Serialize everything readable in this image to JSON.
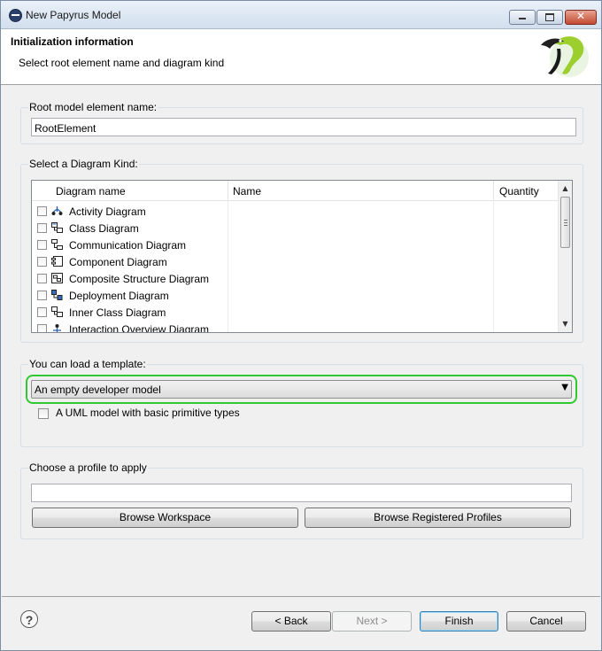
{
  "window": {
    "title": "New Papyrus Model",
    "controls": [
      "minimize-icon",
      "maximize-icon",
      "close-icon"
    ]
  },
  "header": {
    "title": "Initialization information",
    "subtitle": "Select root element name and diagram kind"
  },
  "root_element": {
    "label": "Root model element name:",
    "value": "RootElement"
  },
  "diagram_kind": {
    "label": "Select a Diagram Kind:",
    "columns": [
      "Diagram name",
      "Name",
      "Quantity"
    ],
    "rows": [
      {
        "label": "Activity Diagram",
        "icon": "activity-diagram-icon",
        "checked": false
      },
      {
        "label": "Class Diagram",
        "icon": "class-diagram-icon",
        "checked": false
      },
      {
        "label": "Communication Diagram",
        "icon": "communication-diagram-icon",
        "checked": false
      },
      {
        "label": "Component Diagram",
        "icon": "component-diagram-icon",
        "checked": false
      },
      {
        "label": "Composite Structure Diagram",
        "icon": "composite-structure-diagram-icon",
        "checked": false
      },
      {
        "label": "Deployment Diagram",
        "icon": "deployment-diagram-icon",
        "checked": false
      },
      {
        "label": "Inner Class Diagram",
        "icon": "inner-class-diagram-icon",
        "checked": false
      },
      {
        "label": "Interaction Overview Diagram",
        "icon": "interaction-overview-diagram-icon",
        "checked": false
      }
    ]
  },
  "template": {
    "label": "You can load a template:",
    "selected": "An empty developer model",
    "option_checkbox": "A UML model with basic primitive types",
    "option_checked": false
  },
  "profile": {
    "label": "Choose a profile to apply",
    "value": "",
    "browse_workspace": "Browse Workspace",
    "browse_registered": "Browse Registered Profiles"
  },
  "footer": {
    "help": "?",
    "back": "< Back",
    "next": "Next >",
    "finish": "Finish",
    "cancel": "Cancel"
  },
  "colors": {
    "highlight": "#31c931",
    "default_button_border": "#3c7fb1"
  }
}
